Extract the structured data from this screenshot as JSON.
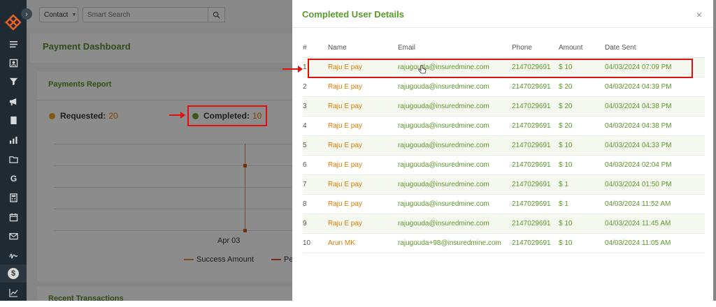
{
  "topbar": {
    "contact_label": "Contact",
    "search_placeholder": "Smart Search"
  },
  "dashboard": {
    "title": "Payment Dashboard"
  },
  "report": {
    "title": "Payments Report",
    "requested_label": "Requested:",
    "requested_value": "20",
    "completed_label": "Completed:",
    "completed_value": "10",
    "x_label": "Apr 03",
    "legend_success": "Success Amount",
    "legend_pending": "Pend"
  },
  "recent": {
    "title": "Recent Transactions"
  },
  "modal": {
    "title": "Completed User Details",
    "close": "×",
    "columns": [
      "#",
      "Name",
      "Email",
      "Phone",
      "Amount",
      "Date Sent"
    ],
    "rows": [
      {
        "num": "1",
        "name": "Raju E pay",
        "email": "rajugouda@insuredmine.com",
        "phone": "2147029691",
        "amount": "$ 10",
        "date": "04/03/2024 07:09 PM"
      },
      {
        "num": "2",
        "name": "Raju E pay",
        "email": "rajugouda@insuredmine.com",
        "phone": "2147029691",
        "amount": "$ 20",
        "date": "04/03/2024 04:39 PM"
      },
      {
        "num": "3",
        "name": "Raju E pay",
        "email": "rajugouda@insuredmine.com",
        "phone": "2147029691",
        "amount": "$ 20",
        "date": "04/03/2024 04:38 PM"
      },
      {
        "num": "4",
        "name": "Raju E pay",
        "email": "rajugouda@insuredmine.com",
        "phone": "2147029691",
        "amount": "$ 20",
        "date": "04/03/2024 04:38 PM"
      },
      {
        "num": "5",
        "name": "Raju E pay",
        "email": "rajugouda@insuredmine.com",
        "phone": "2147029691",
        "amount": "$ 10",
        "date": "04/03/2024 04:33 PM"
      },
      {
        "num": "6",
        "name": "Raju E pay",
        "email": "rajugouda@insuredmine.com",
        "phone": "2147029691",
        "amount": "$ 10",
        "date": "04/03/2024 02:04 PM"
      },
      {
        "num": "7",
        "name": "Raju E pay",
        "email": "rajugouda@insuredmine.com",
        "phone": "2147029691",
        "amount": "$ 1",
        "date": "04/03/2024 01:50 PM"
      },
      {
        "num": "8",
        "name": "Raju E pay",
        "email": "rajugouda@insuredmine.com",
        "phone": "2147029691",
        "amount": "$ 1",
        "date": "04/03/2024 11:52 AM"
      },
      {
        "num": "9",
        "name": "Raju E pay",
        "email": "rajugouda@insuredmine.com",
        "phone": "2147029691",
        "amount": "$ 10",
        "date": "04/03/2024 11:45 AM"
      },
      {
        "num": "10",
        "name": "Arun MK",
        "email": "rajugouda+98@insuredmine.com",
        "phone": "2147029691",
        "amount": "$ 10",
        "date": "04/03/2024 11:05 AM"
      }
    ]
  },
  "sidebar": {
    "icons": [
      "list-icon",
      "contact-card-icon",
      "filter-icon",
      "megaphone-icon",
      "document-icon",
      "bar-chart-icon",
      "folder-icon",
      "google-icon",
      "calculator-icon",
      "calendar-icon",
      "mail-icon",
      "signature-icon",
      "dollar-icon",
      "line-chart-icon"
    ]
  },
  "colors": {
    "accent_green": "#5a9a2a",
    "accent_orange": "#e07b00",
    "highlight_red": "#e01010",
    "sidebar_bg": "#1f2a33"
  }
}
